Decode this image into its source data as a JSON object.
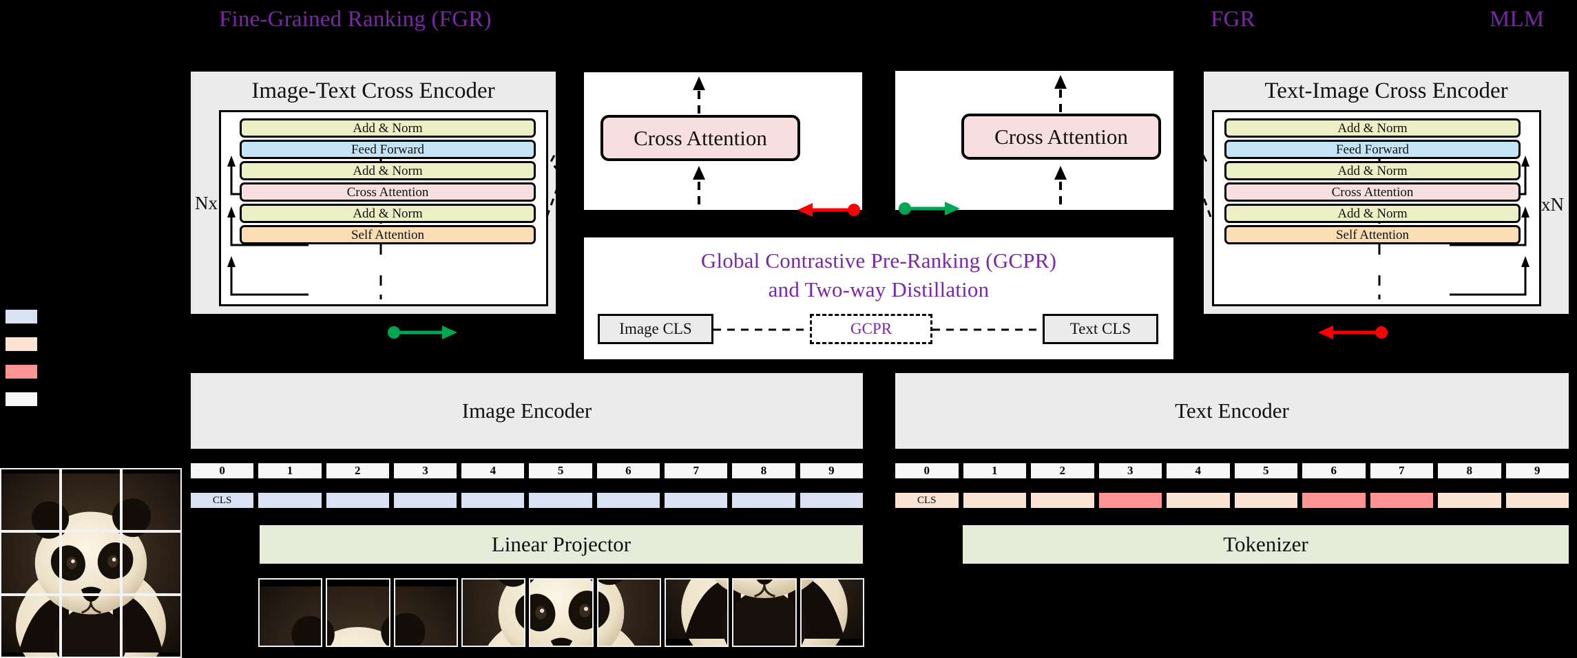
{
  "labels": {
    "fgr_full": "Fine-Grained Ranking (FGR)",
    "fgr_short": "FGR",
    "mlm": "MLM"
  },
  "left_encoder": {
    "title": "Image-Text Cross Encoder",
    "repeat_label": "Nx",
    "layers": [
      {
        "label": "Add & Norm",
        "kind": "addnorm"
      },
      {
        "label": "Feed  Forward",
        "kind": "ff"
      },
      {
        "label": "Add & Norm",
        "kind": "addnorm"
      },
      {
        "label": "Cross  Attention",
        "kind": "cross"
      },
      {
        "label": "Add & Norm",
        "kind": "addnorm"
      },
      {
        "label": "Self  Attention",
        "kind": "self"
      }
    ]
  },
  "right_encoder": {
    "title": "Text-Image Cross Encoder",
    "repeat_label": "xN",
    "layers": [
      {
        "label": "Add & Norm",
        "kind": "addnorm"
      },
      {
        "label": "Feed  Forward",
        "kind": "ff"
      },
      {
        "label": "Add & Norm",
        "kind": "addnorm"
      },
      {
        "label": "Cross  Attention",
        "kind": "cross"
      },
      {
        "label": "Add & Norm",
        "kind": "addnorm"
      },
      {
        "label": "Self  Attention",
        "kind": "self"
      }
    ]
  },
  "cross_attention_left": {
    "label": "Cross Attention"
  },
  "cross_attention_right": {
    "label": "Cross Attention"
  },
  "gcpr": {
    "title_line1": "Global Contrastive Pre-Ranking (GCPR)",
    "title_line2": "and Two-way Distillation",
    "image_cls": "Image CLS",
    "center": "GCPR",
    "text_cls": "Text CLS"
  },
  "encoders": {
    "image": "Image Encoder",
    "text": "Text Encoder"
  },
  "projectors": {
    "image": "Linear Projector",
    "text": "Tokenizer"
  },
  "image_tokens": {
    "positions": [
      "0",
      "1",
      "2",
      "3",
      "4",
      "5",
      "6",
      "7",
      "8",
      "9"
    ],
    "cls_label": "CLS",
    "masked": []
  },
  "text_tokens": {
    "positions": [
      "0",
      "1",
      "2",
      "3",
      "4",
      "5",
      "6",
      "7",
      "8",
      "9"
    ],
    "cls_label": "CLS",
    "masked": [
      3,
      6,
      7
    ]
  },
  "legend": {
    "swatches": [
      "#d9e2f3",
      "#fae3d2",
      "#ff9494",
      "#f7f7f7"
    ]
  },
  "colors": {
    "accent_purple": "#7b27a8",
    "add_norm": "#ecefc4",
    "feed_forward": "#c3e4f5",
    "cross_attention": "#f7dfdf",
    "self_attention": "#fbddb4",
    "panel_gray": "#ebebeb",
    "projector_green": "#e5ecd9",
    "image_token": "#d9e2f3",
    "text_token": "#fae3d2",
    "masked_token": "#ff9494",
    "arrow_green": "#00a651",
    "arrow_red": "#ff0000"
  },
  "arrows": {
    "left_flow": "green-arrow-right",
    "right_flow": "red-arrow-left",
    "left_ca_in": "red-arrow-left",
    "right_ca_in": "green-arrow-right"
  },
  "image_subject": "panda-photo"
}
